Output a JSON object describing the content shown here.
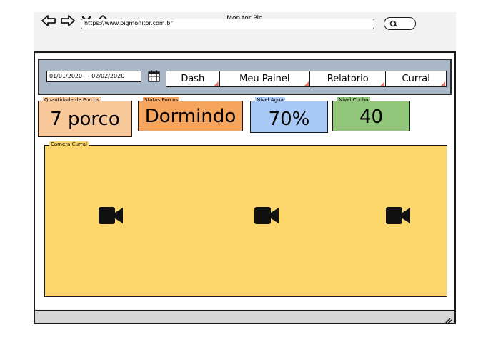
{
  "window": {
    "title": "Monitor Pig"
  },
  "browser": {
    "url": "https://www.pigmonitor.com.br"
  },
  "filters": {
    "date_range": "01/01/2020   - 02/02/2020"
  },
  "tabs": [
    {
      "label": "Dash"
    },
    {
      "label": "Meu Painel"
    },
    {
      "label": "Relatorio"
    },
    {
      "label": "Curral"
    }
  ],
  "cards": {
    "pigs": {
      "label": "Quantidade de Porcos",
      "value": "7 porco",
      "color": "#f8c89a"
    },
    "status": {
      "label": "Status Porcos",
      "value": "Dormindo",
      "color": "#f6a55f"
    },
    "water": {
      "label": "Nivel Agua",
      "value": "70%",
      "color": "#a8c8f6"
    },
    "trough": {
      "label": "Nivel Cocho",
      "value": "40",
      "color": "#91c57a"
    }
  },
  "camera": {
    "label": "Camera Curral",
    "color": "#fcd66b",
    "icons": [
      "video-camera-icon",
      "video-camera-icon",
      "video-camera-icon"
    ]
  }
}
